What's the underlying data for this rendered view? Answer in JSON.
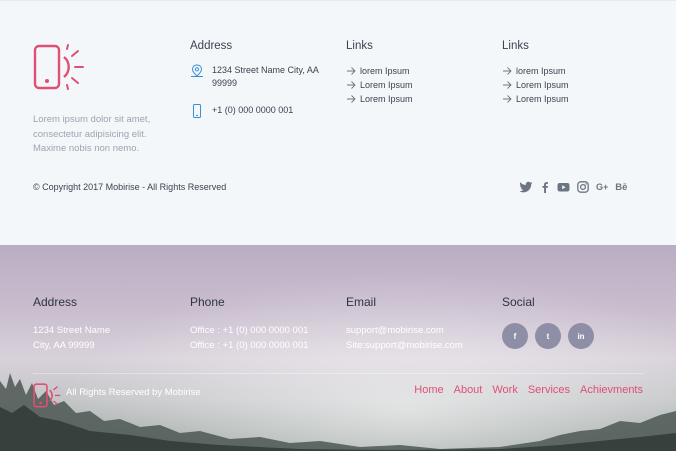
{
  "top_footer": {
    "about_text": "Lorem ipsum dolor sit amet, consectetur adipisicing elit. Maxime nobis non nemo.",
    "address_col": {
      "heading": "Address",
      "address": "1234 Street Name City, AA 99999",
      "phone": "+1 (0) 000 0000 001"
    },
    "links_col_1": {
      "heading": "Links",
      "items": [
        "lorem Ipsum",
        "Lorem Ipsum",
        "Lorem Ipsum"
      ]
    },
    "links_col_2": {
      "heading": "Links",
      "items": [
        "lorem Ipsum",
        "Lorem Ipsum",
        "Lorem Ipsum"
      ]
    },
    "copyright": "© Copyright 2017 Mobirise - All Rights Reserved",
    "social_icons": [
      "twitter-icon",
      "facebook-icon",
      "youtube-icon",
      "instagram-icon",
      "google-plus-icon",
      "behance-icon"
    ],
    "social_glyphs": {
      "google": "G+",
      "behance": "Bē"
    }
  },
  "bottom_footer": {
    "address": {
      "heading": "Address",
      "line1": "1234 Street Name",
      "line2": "City, AA 99999"
    },
    "phone": {
      "heading": "Phone",
      "line1": "Office : +1 (0) 000 0000 001",
      "line2": "Office : +1 (0) 000 0000 001"
    },
    "email": {
      "heading": "Email",
      "line1": "support@mobirise.com",
      "line2": "Site:support@mobirise.com"
    },
    "social": {
      "heading": "Social",
      "items": [
        {
          "icon": "facebook-icon",
          "glyph": "f"
        },
        {
          "icon": "twitter-icon",
          "glyph": "t"
        },
        {
          "icon": "linkedin-icon",
          "glyph": "in"
        }
      ]
    },
    "rights": "All Rights Reserved by Mobirise",
    "menu": [
      "Home",
      "About",
      "Work",
      "Services",
      "Achievments"
    ]
  },
  "colors": {
    "accent": "#e04f74",
    "text": "#3a4350",
    "muted": "#9aa5b1",
    "bg_light": "#f4f7fa"
  }
}
